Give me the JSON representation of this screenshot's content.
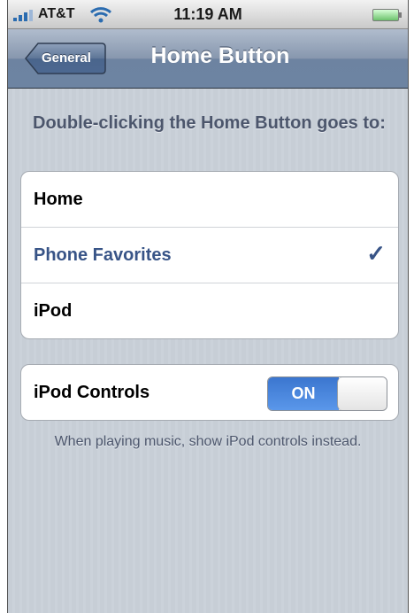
{
  "status_bar": {
    "carrier": "AT&T",
    "time": "11:19 AM",
    "icons": {
      "signal": "signal-bars-icon",
      "wifi": "wifi-icon",
      "battery": "battery-icon"
    }
  },
  "nav": {
    "back_label": "General",
    "title": "Home Button"
  },
  "settings": {
    "section_header": "Double-clicking the Home Button goes to:",
    "options": [
      {
        "label": "Home",
        "selected": false
      },
      {
        "label": "Phone Favorites",
        "selected": true
      },
      {
        "label": "iPod",
        "selected": false
      }
    ],
    "checkmark": "✓",
    "ipod_controls": {
      "label": "iPod Controls",
      "toggle_text": "ON",
      "enabled": true
    },
    "footer_note": "When playing music, show iPod controls instead."
  },
  "colors": {
    "nav_bar": "#6d84a2",
    "selected_text": "#385487",
    "toggle_on": "#3b76cf",
    "background": "#c5ccd4"
  }
}
